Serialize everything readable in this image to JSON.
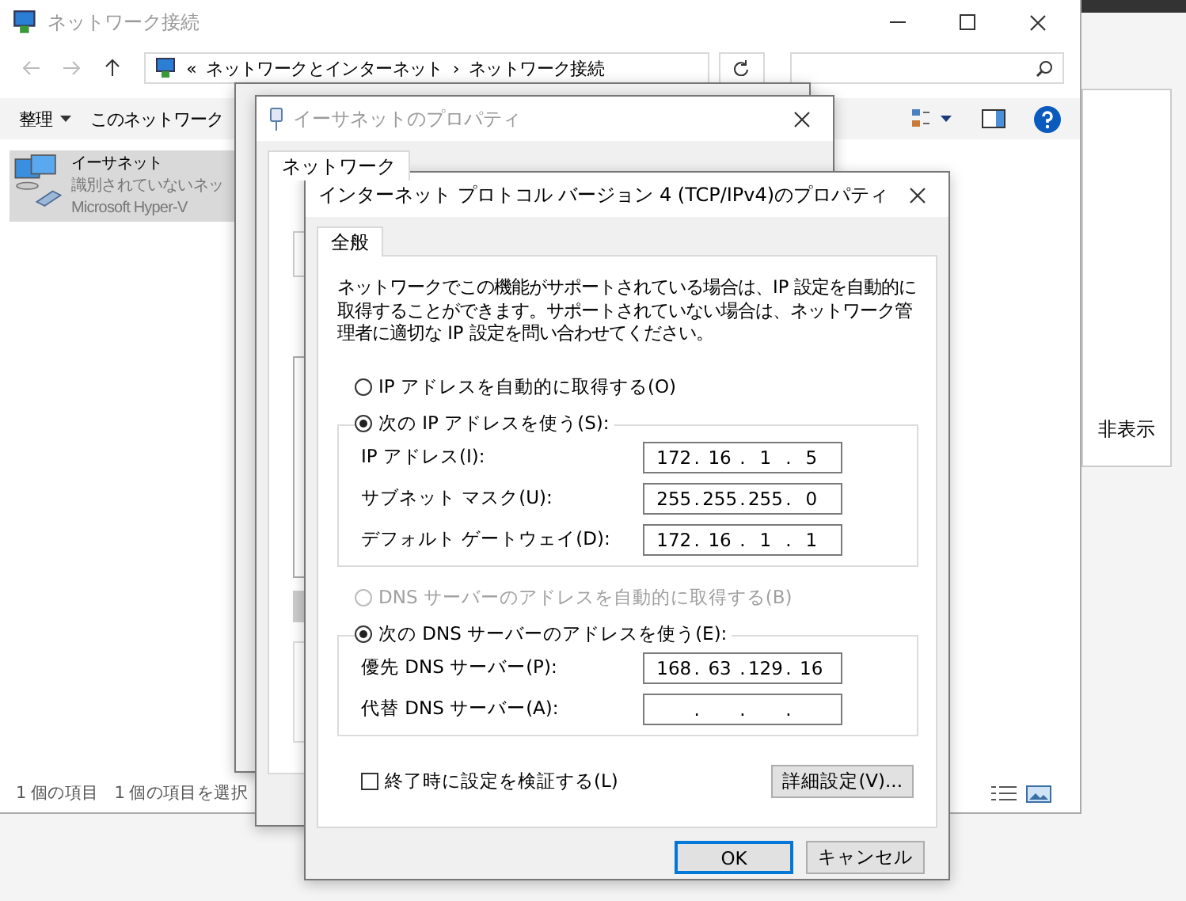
{
  "explorer": {
    "title": "ネットワーク接続",
    "breadcrumb": [
      "«",
      "ネットワークとインターネット",
      "›",
      "ネットワーク接続"
    ],
    "toolbar": [
      "整理",
      "このネットワーク"
    ],
    "items": [
      {
        "name": "イーサネット",
        "status": "識別されていないネッ",
        "device": "Microsoft Hyper-V",
        "selected": true
      }
    ],
    "status_bar": [
      "1 個の項目",
      "1 個の項目を選択"
    ]
  },
  "side_pane": {
    "text": "非表示"
  },
  "properties_window": {
    "title": "イーサネットのプロパティ",
    "tabs": [
      {
        "label": "ネットワーク",
        "selected": true
      }
    ]
  },
  "ipv4_dialog": {
    "title": "インターネット プロトコル バージョン 4 (TCP/IPv4)のプロパティ",
    "tabs": [
      {
        "label": "全般",
        "selected": true
      }
    ],
    "description": "ネットワークでこの機能がサポートされている場合は、IP 設定を自動的に取得することができます。サポートされていない場合は、ネットワーク管理者に適切な IP 設定を問い合わせてください。",
    "separator": ".",
    "ip_mode": [
      {
        "label": "IP アドレスを自動的に取得する(O)",
        "selected": false,
        "disabled": false
      },
      {
        "label": "次の IP アドレスを使う(S):",
        "selected": true,
        "disabled": false
      }
    ],
    "ip_fields": [
      {
        "label": "IP アドレス(I):",
        "octets": [
          "172",
          "16",
          "1",
          "5"
        ]
      },
      {
        "label": "サブネット マスク(U):",
        "octets": [
          "255",
          "255",
          "255",
          "0"
        ]
      },
      {
        "label": "デフォルト ゲートウェイ(D):",
        "octets": [
          "172",
          "16",
          "1",
          "1"
        ]
      }
    ],
    "dns_mode": [
      {
        "label": "DNS サーバーのアドレスを自動的に取得する(B)",
        "selected": false,
        "disabled": true
      },
      {
        "label": "次の DNS サーバーのアドレスを使う(E):",
        "selected": true,
        "disabled": false
      }
    ],
    "dns_fields": [
      {
        "label": "優先 DNS サーバー(P):",
        "octets": [
          "168",
          "63",
          "129",
          "16"
        ]
      },
      {
        "label": "代替 DNS サーバー(A):"
      }
    ],
    "validate": {
      "label": "終了時に設定を検証する(L)",
      "checked": false
    },
    "advanced_button": "詳細設定(V)...",
    "buttons": [
      {
        "label": "OK",
        "default": true
      },
      {
        "label": "キャンセル",
        "default": false
      }
    ]
  }
}
